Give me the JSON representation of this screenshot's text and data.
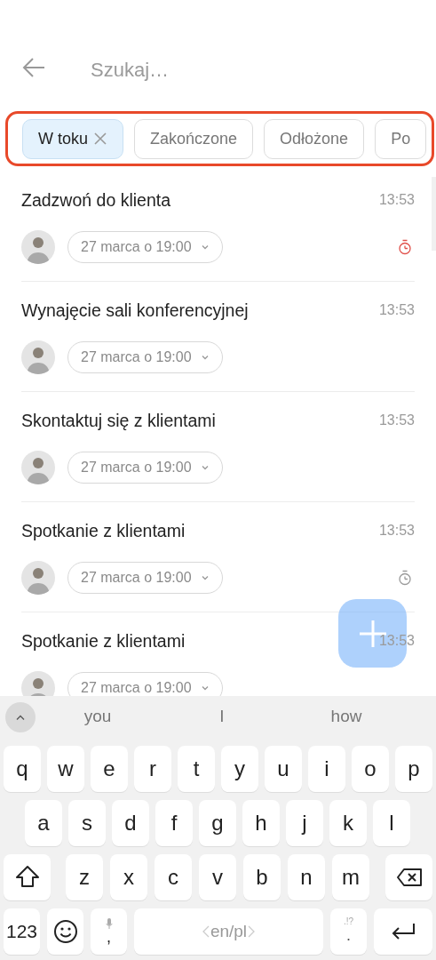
{
  "search": {
    "placeholder": "Szukaj…"
  },
  "filters": [
    {
      "label": "W toku",
      "selected": true
    },
    {
      "label": "Zakończone",
      "selected": false
    },
    {
      "label": "Odłożone",
      "selected": false
    },
    {
      "label": "Po",
      "selected": false
    }
  ],
  "tasks": [
    {
      "title": "Zadzwoń do klienta",
      "time": "13:53",
      "due": "27 marca o 19:00",
      "reminder": true,
      "overdue": true
    },
    {
      "title": "Wynajęcie sali konferencyjnej",
      "time": "13:53",
      "due": "27 marca o 19:00",
      "reminder": false
    },
    {
      "title": "Skontaktuj się z klientami",
      "time": "13:53",
      "due": "27 marca o 19:00",
      "reminder": false
    },
    {
      "title": "Spotkanie z klientami",
      "time": "13:53",
      "due": "27 marca o 19:00",
      "reminder": true,
      "overdue": false
    },
    {
      "title": "Spotkanie z klientami",
      "time": "13:53",
      "due": "27 marca o 19:00",
      "reminder": false
    }
  ],
  "keyboard": {
    "suggestions": [
      "you",
      "I",
      "how"
    ],
    "letter_rows": [
      [
        "q",
        "w",
        "e",
        "r",
        "t",
        "y",
        "u",
        "i",
        "o",
        "p"
      ],
      [
        "a",
        "s",
        "d",
        "f",
        "g",
        "h",
        "j",
        "k",
        "l"
      ],
      [
        "z",
        "x",
        "c",
        "v",
        "b",
        "n",
        "m"
      ]
    ],
    "bottom_row": [
      {
        "kind": "symbols",
        "label": "123"
      },
      {
        "kind": "emoji"
      },
      {
        "kind": "comma",
        "label": ","
      },
      {
        "kind": "space",
        "label": "en/pl"
      },
      {
        "kind": "period",
        "label": ".",
        "hint": ".!?"
      },
      {
        "kind": "enter"
      }
    ]
  }
}
